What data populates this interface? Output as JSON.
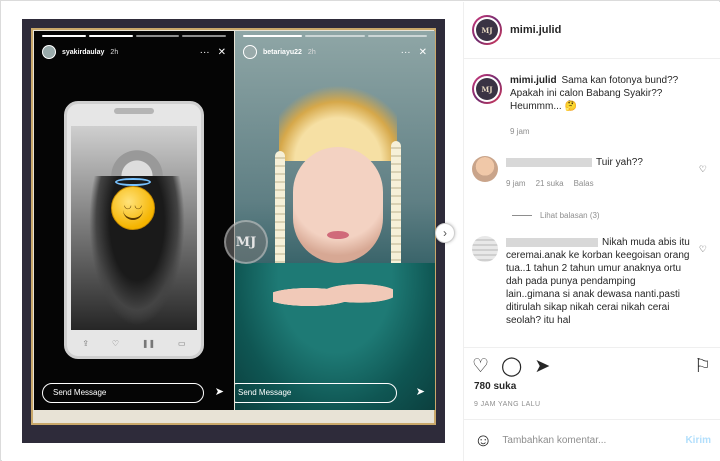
{
  "story_left": {
    "username": "syakirdaulay",
    "time": "2h",
    "more": "···",
    "close": "✕",
    "send_placeholder": "Send Message",
    "send_icon": "➤"
  },
  "story_right": {
    "username": "betariayu22",
    "time": "2h",
    "more": "···",
    "close": "✕",
    "send_placeholder": "Send Message",
    "send_icon": "➤"
  },
  "watermark": "MJ",
  "next_arrow": "›",
  "header": {
    "username": "mimi.julid",
    "avatar_text": "MJ"
  },
  "caption": {
    "username": "mimi.julid",
    "text": "Sama kan fotonya bund?? Apakah ini calon Babang Syakir?? Heummm... 🤔",
    "time": "9 jam"
  },
  "comments": [
    {
      "text": "Tuir yah??",
      "time": "9 jam",
      "likes": "21 suka",
      "reply": "Balas"
    },
    {
      "text": "Nikah muda abis itu ceremai.anak ke korban keegoisan orang tua..1 tahun 2 tahun umur anaknya ortu dah pada punya pendamping lain..gimana si anak dewasa nanti.pasti ditirulah sikap nikah cerai nikah cerai seolah? itu hal"
    }
  ],
  "view_replies": "Lihat balasan (3)",
  "actions": {
    "like": "♡",
    "comment": "◯",
    "share": "➤",
    "save": "⚐"
  },
  "likes": "780 suka",
  "time_ago": "9 JAM YANG LALU",
  "comment_box": {
    "emoji": "☺",
    "placeholder": "Tambahkan komentar...",
    "post": "Kirim"
  },
  "colors": {
    "accent": "#b2dffc",
    "frame": "#2e2b3a",
    "gold": "#c9a86a"
  }
}
